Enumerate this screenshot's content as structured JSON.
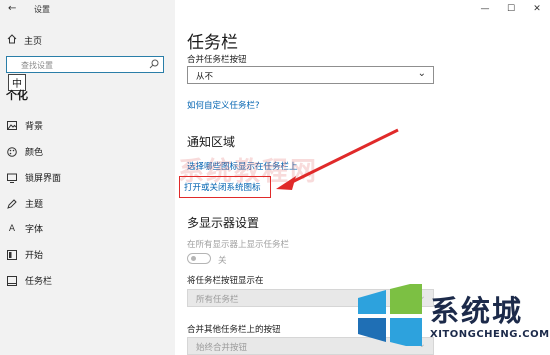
{
  "window": {
    "back": "←",
    "title": "设置",
    "minimize": "—",
    "maximize": "☐",
    "close": "✕"
  },
  "sidebar": {
    "home": "主页",
    "search_placeholder": "查找设置",
    "ime": "中",
    "section_fragment": "个化",
    "items": [
      {
        "label": "背景",
        "icon": "image-icon"
      },
      {
        "label": "颜色",
        "icon": "palette-icon"
      },
      {
        "label": "锁屏界面",
        "icon": "lock-screen-icon"
      },
      {
        "label": "主题",
        "icon": "pen-icon"
      },
      {
        "label": "字体",
        "icon": "font-icon"
      },
      {
        "label": "开始",
        "icon": "start-icon"
      },
      {
        "label": "任务栏",
        "icon": "taskbar-icon"
      }
    ]
  },
  "main": {
    "title": "任务栏",
    "combine_label": "合并任务栏按钮",
    "combine_value": "从不",
    "customize_link": "如何自定义任务栏?",
    "notification_heading": "通知区域",
    "notification_link1": "选择哪些图标显示在任务栏上",
    "notification_link2": "打开或关闭系统图标",
    "multi_display_heading": "多显示器设置",
    "show_all_label": "在所有显示器上显示任务栏",
    "toggle_state": "关",
    "show_buttons_label": "将任务栏按钮显示在",
    "show_buttons_value": "所有任务栏",
    "combine_other_label": "合并其他任务栏上的按钮",
    "combine_other_value": "始终合并按钮"
  },
  "watermark": {
    "text": "系统教程网"
  },
  "logo": {
    "cn": "系统城",
    "en": "XITONGCHENG.COM"
  },
  "colors": {
    "accent": "#0063b1",
    "highlight": "#e02a2a",
    "sidebar_bg": "#f2f2f2"
  }
}
